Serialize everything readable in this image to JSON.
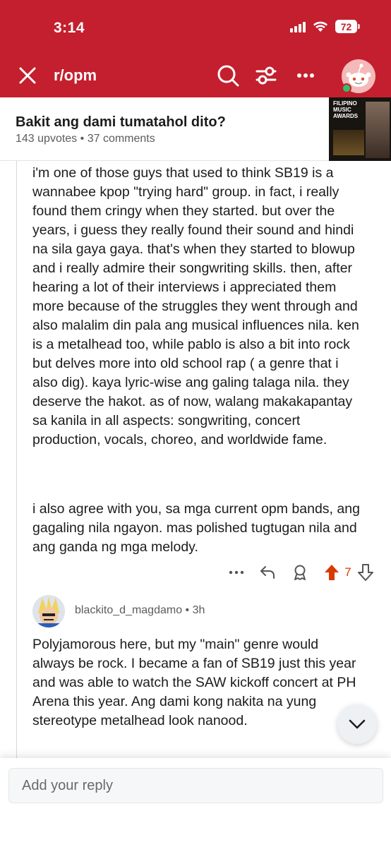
{
  "status_bar": {
    "time": "3:14",
    "battery": "72"
  },
  "nav": {
    "subreddit": "r/opm"
  },
  "post": {
    "title": "Bakit ang dami tumatahol dito?",
    "upvotes": "143 upvotes",
    "separator": "•",
    "comments": "37 comments",
    "thumbnail_text": "FILIPINO MUSIC AWARDS"
  },
  "comment1": {
    "paragraph1": "i'm one of those guys that used to think SB19 is a wannabee kpop \"trying hard\" group. in fact, i really found them cringy when they started. but over the years, i guess they really found their sound and hindi na sila gaya gaya. that's when they started to blowup and i really admire their songwriting skills. then, after hearing a lot of their interviews i appreciated them more because of the struggles they went through and also malalim din pala ang musical influences nila. ken is a metalhead too, while pablo is also a bit into rock but delves more into old school rap ( a genre that i also dig). kaya lyric-wise ang galing talaga nila. they deserve the hakot. as of now, walang makakapantay sa kanila in all aspects: songwriting, concert production, vocals, choreo, and worldwide fame.",
    "paragraph2": "i also agree with you, sa mga current opm bands, ang gagaling nila ngayon. mas polished tugtugan nila and ang ganda ng mga melody.",
    "vote_count": "7"
  },
  "comment2": {
    "username": "blackito_d_magdamo",
    "separator": "•",
    "age": "3h",
    "body": "Polyjamorous here, but my \"main\" genre would always be rock. I became a fan of SB19 just this year and was able to watch the SAW kickoff concert at PH Arena this year. Ang dami kong nakita na yung stereotype metalhead look nanood."
  },
  "reply": {
    "placeholder": "Add your reply"
  },
  "colors": {
    "header": "#c41f2e",
    "upvote": "#d93a00"
  }
}
